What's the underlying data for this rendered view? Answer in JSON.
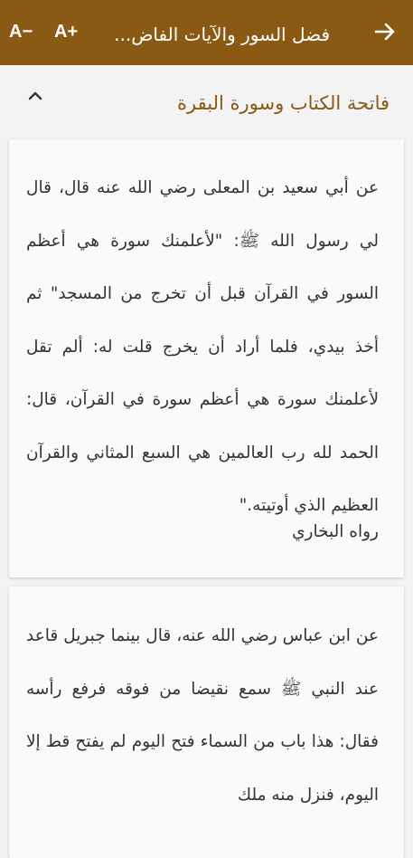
{
  "appbar": {
    "title": "فضل السور والآيات الفاض...",
    "font_decrease_label": "A−",
    "font_increase_label": "A+",
    "back_icon": "arrow-right-icon",
    "background": "#8a5a14"
  },
  "section": {
    "title": "فاتحة الكتاب وسورة البقرة",
    "collapse_icon": "chevron-up-icon",
    "title_color": "#8a5a14"
  },
  "hadiths": [
    {
      "text": "عن أبي سعيد بن المعلى رضي الله عنه قال، قال لي رسول الله ﷺ: \"لأعلمنك سورة هي أعظم السور في القرآن قبل أن تخرج من المسجد\" ثم أخذ بيدي، فلما أراد أن يخرج قلت له: ألم تقل لأعلمنك سورة هي أعظم سورة في القرآن، قال: الحمد لله رب العالمين هي السبع المثاني والقرآن العظيم الذي أوتيته.\"",
      "source": "رواه البخاري"
    },
    {
      "text": "عن ابن عباس رضي الله عنه، قال بينما جبريل قاعد عند النبي ﷺ سمع نقيضا من فوقه فرفع رأسه فقال: هذا باب من السماء فتح اليوم لم يفتح قط إلا اليوم، فنزل منه ملك"
    }
  ]
}
